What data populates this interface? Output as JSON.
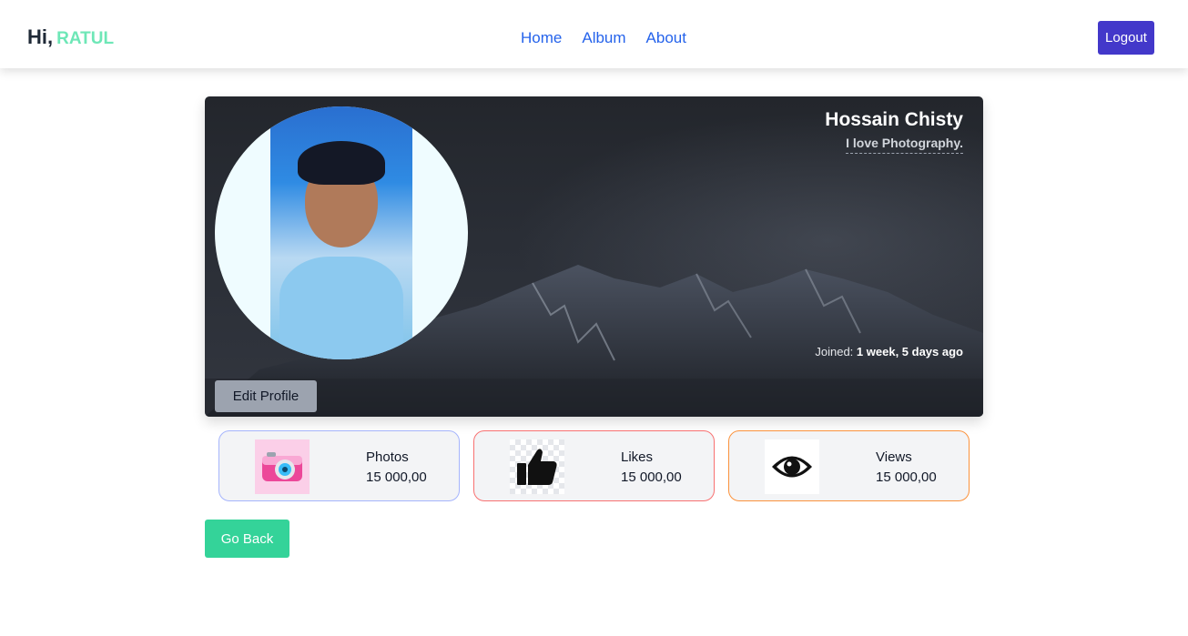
{
  "header": {
    "greeting": "Hi,",
    "username": "RATUL",
    "nav": [
      {
        "label": "Home"
      },
      {
        "label": "Album"
      },
      {
        "label": "About"
      }
    ],
    "logout_label": "Logout"
  },
  "profile": {
    "name": "Hossain Chisty",
    "tagline": "I love Photography.",
    "joined_label": "Joined:",
    "joined_value": "1 week, 5 days ago",
    "edit_label": "Edit Profile"
  },
  "stats": [
    {
      "label": "Photos",
      "value": "15 000,00",
      "icon": "camera-icon",
      "border": "#a5b4fc"
    },
    {
      "label": "Likes",
      "value": "15 000,00",
      "icon": "thumbs-up-icon",
      "border": "#f87171"
    },
    {
      "label": "Views",
      "value": "15 000,00",
      "icon": "eye-icon",
      "border": "#fb923c"
    }
  ],
  "go_back_label": "Go Back",
  "colors": {
    "accent": "#4338ca",
    "username": "#6ee7b7",
    "nav_link": "#2563eb",
    "go_back": "#34d399"
  }
}
